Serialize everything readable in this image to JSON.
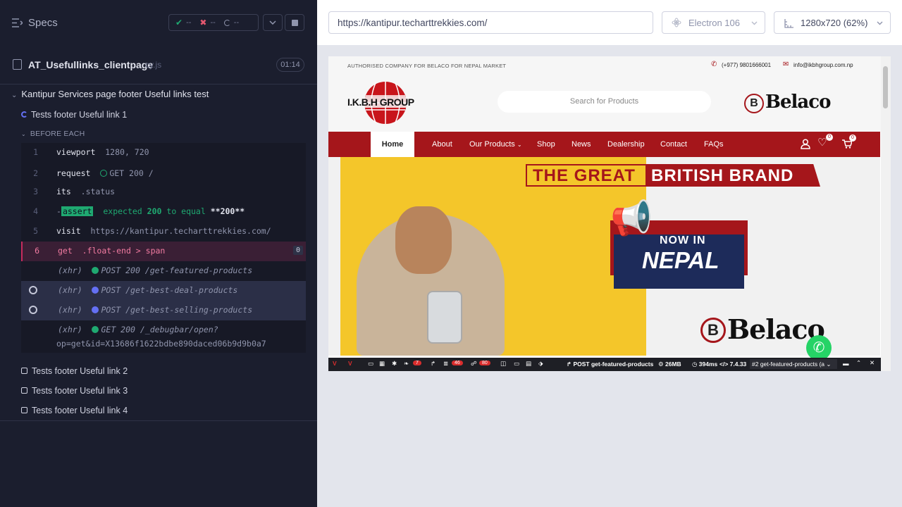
{
  "sidebar": {
    "title": "Specs",
    "stats": {
      "passed": "--",
      "failed": "--",
      "pending": "--"
    },
    "file": {
      "name": "AT_Usefullinks_clientpage",
      "ext": "cy.js",
      "duration": "01:14"
    },
    "suite": "Kantipur Services page footer Useful links test",
    "running_test": "Tests footer Useful link 1",
    "hook": "BEFORE EACH",
    "commands": [
      {
        "num": "1",
        "name": "viewport",
        "msg": "1280, 720"
      },
      {
        "num": "2",
        "name": "request",
        "msg": "GET 200 /"
      },
      {
        "num": "3",
        "name": "its",
        "msg": ".status"
      },
      {
        "num": "4",
        "prefix": "-",
        "name": "assert",
        "msg": "expected 200 to equal **200**",
        "msg_a": "expected",
        "msg_b": "200",
        "msg_c": "to equal",
        "msg_d": "**200**"
      },
      {
        "num": "5",
        "name": "visit",
        "msg": "https://kantipur.techarttrekkies.com/"
      },
      {
        "num": "6",
        "name": "get",
        "msg": ".float-end > span",
        "count": "0"
      },
      {
        "name": "(xhr)",
        "msg": "POST 200 /get-featured-products"
      },
      {
        "name": "(xhr)",
        "msg": "POST /get-best-deal-products"
      },
      {
        "name": "(xhr)",
        "msg": "POST /get-best-selling-products"
      },
      {
        "name": "(xhr)",
        "msg": "GET 200 /_debugbar/open?",
        "msg2": "op=get&id=X13686f1622bdbe890daced06b9d9b0a7"
      }
    ],
    "other_tests": [
      "Tests footer Useful link 2",
      "Tests footer Useful link 3",
      "Tests footer Useful link 4"
    ]
  },
  "toolbar": {
    "url": "https://kantipur.techarttrekkies.com/",
    "browser": "Electron 106",
    "viewport": "1280x720  (62%)"
  },
  "site": {
    "top_left": "AUTHORISED COMPANY FOR BELACO FOR NEPAL MARKET",
    "phone": "(+977) 9801666001",
    "email": "info@ikbhgroup.com.np",
    "logo_left": "I.K.B.H GROUP",
    "search_placeholder": "Search for Products",
    "logo_right": "Belaco",
    "nav": [
      "Home",
      "About",
      "Our Products",
      "Shop",
      "News",
      "Dealership",
      "Contact",
      "FAQs"
    ],
    "wishlist_count": "0",
    "cart_count": "0",
    "banner": {
      "line1a": "THE GREAT",
      "line1b": "BRITISH BRAND",
      "now_in": "NOW IN",
      "nepal": "NEPAL",
      "brand": "Belaco"
    },
    "debugbar": {
      "b1": "7",
      "b2": "46",
      "b3": "80",
      "request": "POST get-featured-products",
      "mem": "26MB",
      "time": "394ms",
      "php": "7.4.33",
      "req_select": "#2 get-featured-products (a"
    }
  }
}
